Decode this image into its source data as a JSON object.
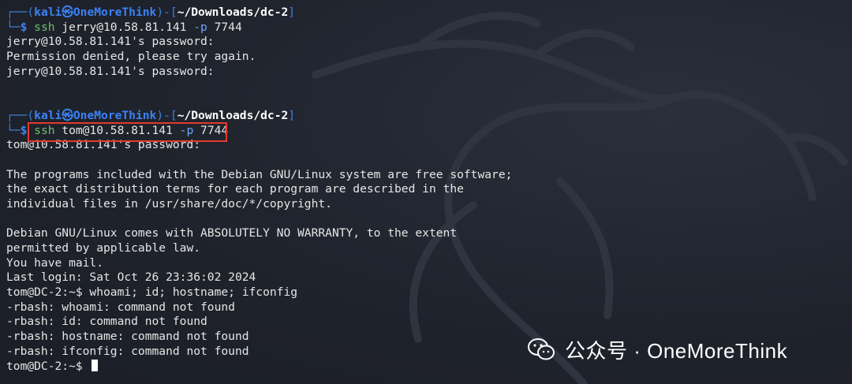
{
  "prompt1": {
    "corner_top": "┌──(",
    "user": "kali㉿OneMoreThink",
    "mid": ")-[",
    "path": "~/Downloads/dc-2",
    "end": "]",
    "corner_bottom": "└─",
    "dollar": "$ ",
    "cmd": "ssh",
    "args": " jerry@10.58.81.141 ",
    "opt": "-p",
    "port": " 7744"
  },
  "output1": [
    "jerry@10.58.81.141's password:",
    "Permission denied, please try again.",
    "jerry@10.58.81.141's password:"
  ],
  "prompt2": {
    "corner_top": "┌──(",
    "user": "kali㉿OneMoreThink",
    "mid": ")-[",
    "path": "~/Downloads/dc-2",
    "end": "]",
    "corner_bottom": "└─",
    "dollar": "$ ",
    "cmd": "ssh",
    "args": " tom@10.58.81.141 ",
    "opt": "-p",
    "port": " 7744"
  },
  "output2": [
    "tom@10.58.81.141's password:",
    "",
    "The programs included with the Debian GNU/Linux system are free software;",
    "the exact distribution terms for each program are described in the",
    "individual files in /usr/share/doc/*/copyright.",
    "",
    "Debian GNU/Linux comes with ABSOLUTELY NO WARRANTY, to the extent",
    "permitted by applicable law.",
    "You have mail.",
    "Last login: Sat Oct 26 23:36:02 2024",
    "tom@DC-2:~$ whoami; id; hostname; ifconfig",
    "-rbash: whoami: command not found",
    "-rbash: id: command not found",
    "-rbash: hostname: command not found",
    "-rbash: ifconfig: command not found"
  ],
  "final_prompt": "tom@DC-2:~$ ",
  "watermark": {
    "icon": "wechat-icon",
    "text": "公众号 · OneMoreThink"
  },
  "colors": {
    "background": "#1f232c",
    "prompt_blue": "#3b82f6",
    "command_green": "#6fbf6f",
    "highlight_red": "#e23a2e"
  }
}
